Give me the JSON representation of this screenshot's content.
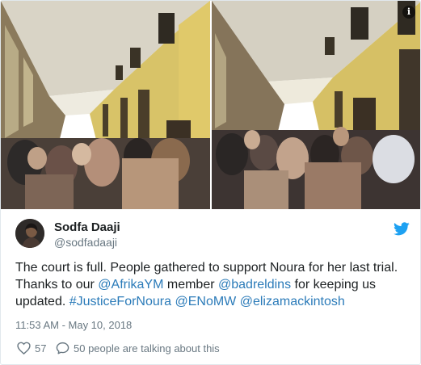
{
  "media": {
    "info_icon": "info-icon",
    "info_glyph": "i"
  },
  "author": {
    "name": "Sodfa Daaji",
    "handle": "@sodfadaaji",
    "avatar_icon": "avatar"
  },
  "brand": {
    "icon": "twitter-bird-icon",
    "color": "#1da1f2"
  },
  "tweet": {
    "line1": "The court is full. People gathered to support Noura for her last trial.",
    "line2_prefix": "Thanks to our ",
    "mention1": "@AfrikaYM",
    "line2_mid": " member ",
    "mention2": "@badreldins",
    "line2_suffix": " for keeping us",
    "line3_prefix": "updated. ",
    "hashtag": "#JusticeForNoura",
    "space1": " ",
    "mention3": "@ENoMW",
    "space2": " ",
    "mention4": "@elizamackintosh"
  },
  "timestamp": "11:53 AM - May 10, 2018",
  "actions": {
    "like_icon": "heart-icon",
    "like_count": "57",
    "reply_icon": "speech-bubble-icon",
    "talking_label": "50 people are talking about this"
  },
  "colors": {
    "link": "#2b7bb9",
    "text": "#1c2022",
    "muted": "#697882"
  }
}
